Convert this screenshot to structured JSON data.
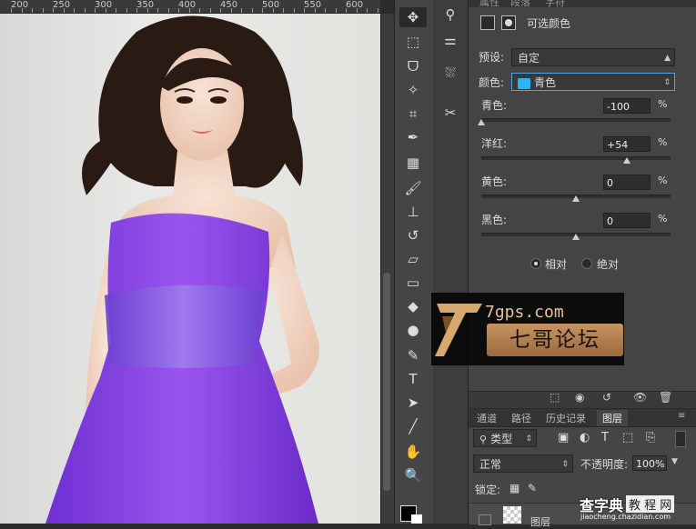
{
  "ruler": {
    "labels": [
      "200",
      "250",
      "300",
      "350",
      "400",
      "450",
      "500",
      "550",
      "600"
    ]
  },
  "toolbar": {
    "tools": [
      {
        "name": "move-tool",
        "glyph": "✥"
      },
      {
        "name": "marquee-tool",
        "glyph": "⬚"
      },
      {
        "name": "lasso-tool",
        "glyph": "ᗜ"
      },
      {
        "name": "magic-wand-tool",
        "glyph": "✧"
      },
      {
        "name": "crop-tool",
        "glyph": "⌗"
      },
      {
        "name": "eyedropper-tool",
        "glyph": "✒"
      },
      {
        "name": "healing-brush-tool",
        "glyph": "▦"
      },
      {
        "name": "brush-tool",
        "glyph": "🖌"
      },
      {
        "name": "clone-stamp-tool",
        "glyph": "⊥"
      },
      {
        "name": "history-brush-tool",
        "glyph": "↺"
      },
      {
        "name": "eraser-tool",
        "glyph": "▱"
      },
      {
        "name": "gradient-tool",
        "glyph": "▭"
      },
      {
        "name": "blur-tool",
        "glyph": "◆"
      },
      {
        "name": "dodge-tool",
        "glyph": "●"
      },
      {
        "name": "pen-tool",
        "glyph": "✎"
      },
      {
        "name": "type-tool",
        "glyph": "T"
      },
      {
        "name": "path-selection-tool",
        "glyph": "➤"
      },
      {
        "name": "line-tool",
        "glyph": "╱"
      },
      {
        "name": "hand-tool",
        "glyph": "✋"
      },
      {
        "name": "zoom-tool",
        "glyph": "🔍"
      }
    ]
  },
  "properties": {
    "tabs": [
      "属性",
      "段落",
      "字符"
    ],
    "title": "可选颜色",
    "preset_label": "预设:",
    "preset_value": "自定",
    "color_label": "颜色:",
    "color_value": "青色",
    "color_swatch": "#29b6f6",
    "sliders": [
      {
        "label": "青色:",
        "value": "-100",
        "pct": "%",
        "level": -100
      },
      {
        "label": "洋红:",
        "value": "+54",
        "pct": "%",
        "level": 54
      },
      {
        "label": "黄色:",
        "value": "0",
        "pct": "%",
        "level": 0
      },
      {
        "label": "黑色:",
        "value": "0",
        "pct": "%",
        "level": 0
      }
    ],
    "mode_relative": "相对",
    "mode_absolute": "绝对",
    "mode_selected": "relative"
  },
  "layers": {
    "tabs": [
      "通道",
      "路径",
      "历史记录",
      "图层"
    ],
    "active_tab": "图层",
    "filter_label": "类型",
    "blend_mode": "正常",
    "opacity_label": "不透明度:",
    "opacity_value": "100%",
    "lock_label": "锁定:",
    "layer_name": "图层"
  },
  "watermark": {
    "site": "7gps.com",
    "name": "七哥论坛",
    "site_short": "G"
  },
  "footer_watermark": {
    "brand": "查字典",
    "tutorial": "教 程 网",
    "url": "jiaocheng.chazidian.com"
  },
  "colors": {
    "accent": "#29b6f6",
    "dress": "#8a3de0",
    "panel": "#444444"
  }
}
